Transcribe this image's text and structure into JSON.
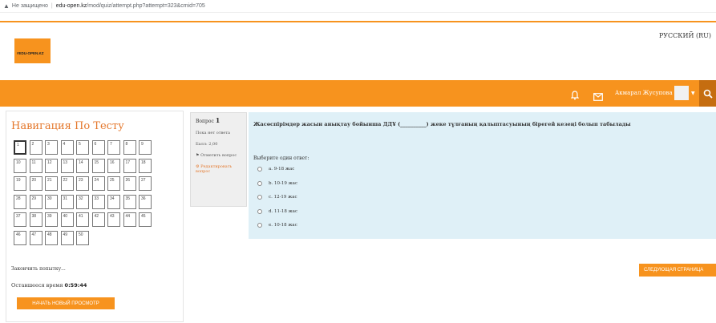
{
  "browser": {
    "security_label": "Не защищено",
    "url_host": "edu-open.kz",
    "url_path": "/mod/quiz/attempt.php?attempt=323&cmid=705"
  },
  "header": {
    "logo_text": "#EDU-OPEN.KZ",
    "language": "РУССКИЙ (RU)",
    "user_name": "Акмарал Жусупова",
    "brand_color": "#f7931e"
  },
  "quiz_nav": {
    "title": "Навигация По Тесту",
    "questions": [
      "1",
      "2",
      "3",
      "4",
      "5",
      "6",
      "7",
      "8",
      "9",
      "10",
      "11",
      "12",
      "13",
      "14",
      "15",
      "16",
      "17",
      "18",
      "19",
      "20",
      "21",
      "22",
      "23",
      "24",
      "25",
      "26",
      "27",
      "28",
      "29",
      "30",
      "31",
      "32",
      "33",
      "34",
      "35",
      "36",
      "37",
      "38",
      "39",
      "40",
      "41",
      "42",
      "43",
      "44",
      "45",
      "46",
      "47",
      "48",
      "49",
      "50"
    ],
    "current": "1",
    "finish_attempt": "Закончить попытку...",
    "time_left_label": "Оставшееся время",
    "time_left_value": "0:59:44",
    "new_view_button": "НАЧАТЬ НОВЫЙ ПРОСМОТР"
  },
  "question_info": {
    "label": "Вопрос",
    "number": "1",
    "status": "Пока нет ответа",
    "score": "Балл: 2,00",
    "flag_label": "Отметить вопрос",
    "edit_label": "Редактировать вопрос"
  },
  "question": {
    "text": "Жасөспірімдер жасын анықтау бойынша ДДҰ (__________) жеке тұлғаның қалыптасуының бірегей кезеңі болып табылады",
    "prompt": "Выберите один ответ:",
    "options": [
      "a. 9-18 жас",
      "b. 10-19 жас",
      "c. 12-19 жас",
      "d. 11-18 жас",
      "e. 10-18 жас"
    ]
  },
  "footer": {
    "next_page_button": "СЛЕДУЮЩАЯ СТРАНИЦА"
  }
}
